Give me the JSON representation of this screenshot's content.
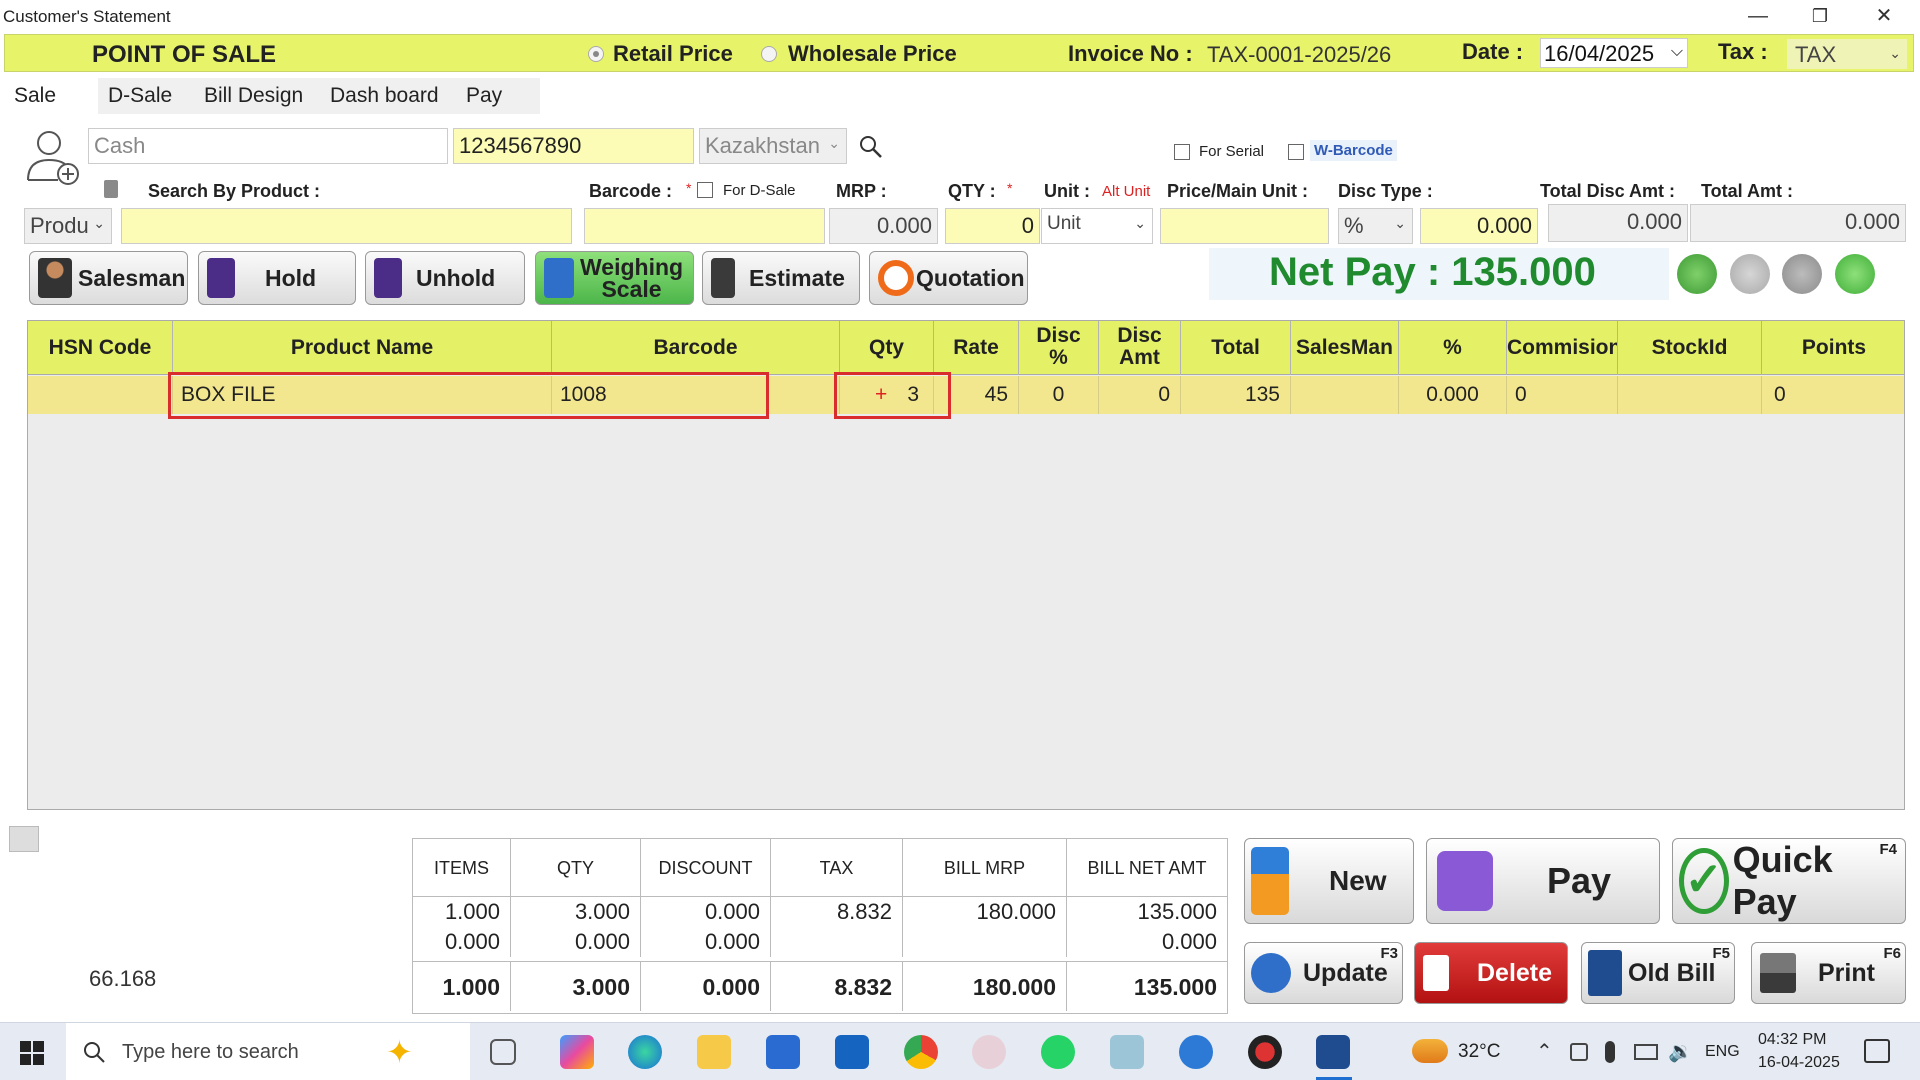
{
  "window": {
    "title": "Customer's Statement",
    "minimize": "—",
    "restore": "❐",
    "close": "✕"
  },
  "header": {
    "title": "POINT OF SALE",
    "price_options": [
      "Retail Price",
      "Wholesale Price"
    ],
    "invoice_label": "Invoice No :",
    "invoice_no": "TAX-0001-2025/26",
    "date_label": "Date :",
    "date_value": "16/04/2025",
    "tax_label": "Tax :",
    "tax_value": "TAX"
  },
  "tabs": [
    "Sale",
    "D-Sale",
    "Bill Design",
    "Dash board",
    "Pay"
  ],
  "customer": {
    "name_placeholder": "Cash",
    "phone": "1234567890",
    "country": "Kazakhstan"
  },
  "options": {
    "for_serial": "For Serial",
    "w_barcode": "W-Barcode",
    "for_dsale": "For D-Sale"
  },
  "labels": {
    "search_by_product": "Search By Product :",
    "barcode": "Barcode :",
    "mrp": "MRP :",
    "qty": "QTY :",
    "unit": "Unit :",
    "alt_unit": "Alt Unit",
    "price_main_unit": "Price/Main Unit :",
    "disc_type": "Disc Type :",
    "total_disc_amt": "Total Disc Amt :",
    "total_amt": "Total Amt :",
    "required": "*"
  },
  "inputs": {
    "search_mode": "Produ",
    "mrp": "0.000",
    "qty": "0",
    "unit": "Unit",
    "disc_type": "%",
    "disc_value": "0.000",
    "total_disc_amt": "0.000",
    "total_amt": "0.000"
  },
  "buttons": {
    "salesman": "Salesman",
    "hold": "Hold",
    "unhold": "Unhold",
    "weighing_1": "Weighing",
    "weighing_2": "Scale",
    "estimate": "Estimate",
    "quotation": "Quotation"
  },
  "net_pay": "Net Pay : 135.000",
  "grid": {
    "columns": [
      "HSN Code",
      "Product Name",
      "Barcode",
      "Qty",
      "Rate",
      "Disc %",
      "Disc Amt",
      "Total",
      "SalesMan",
      "%",
      "Commision",
      "StockId",
      "Points"
    ],
    "col_disc_pct_1": "Disc",
    "col_disc_pct_2": "%",
    "col_disc_amt_1": "Disc",
    "col_disc_amt_2": "Amt",
    "rows": [
      {
        "hsn": "",
        "product": "BOX FILE",
        "barcode": "1008",
        "qty_plus": "+",
        "qty": "3",
        "rate": "45",
        "disc_pct": "0",
        "disc_amt": "0",
        "total": "135",
        "salesman": "",
        "pct": "0.000",
        "commision": "0",
        "stockid": "",
        "points": "0"
      }
    ]
  },
  "side_value": "66.168",
  "summary": {
    "headers": [
      "ITEMS",
      "QTY",
      "DISCOUNT",
      "TAX",
      "BILL MRP",
      "BILL NET AMT"
    ],
    "row1": [
      "1.000",
      "3.000",
      "0.000",
      "8.832",
      "180.000",
      "135.000"
    ],
    "row2": [
      "0.000",
      "0.000",
      "0.000",
      "",
      "",
      "0.000"
    ],
    "total": [
      "1.000",
      "3.000",
      "0.000",
      "8.832",
      "180.000",
      "135.000"
    ]
  },
  "actions": {
    "new": "New",
    "pay": "Pay",
    "quick_pay": "Quick Pay",
    "quick_pay_key": "F4",
    "update": "Update",
    "update_key": "F3",
    "delete": "Delete",
    "old_bill": "Old Bill",
    "old_bill_key": "F5",
    "print": "Print",
    "print_key": "F6"
  },
  "taskbar": {
    "search_placeholder": "Type here to search",
    "weather": "32°C",
    "lang": "ENG",
    "time": "04:32 PM",
    "date": "16-04-2025"
  },
  "colors": {
    "accent_yellow": "#e7f46a",
    "row_yellow": "#f2e78e",
    "net_pay_green": "#1f8a2e",
    "highlight_red": "#d92d2d"
  }
}
